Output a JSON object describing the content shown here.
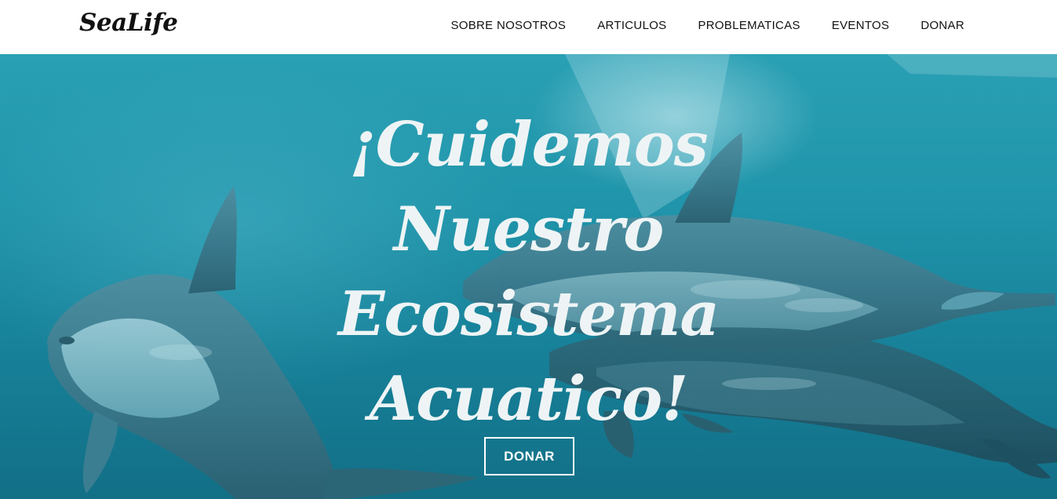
{
  "brand": {
    "name": "SeaLife"
  },
  "nav": {
    "items": [
      {
        "label": "SOBRE NOSOTROS"
      },
      {
        "label": "ARTICULOS"
      },
      {
        "label": "PROBLEMATICAS"
      },
      {
        "label": "EVENTOS"
      },
      {
        "label": "DONAR"
      }
    ]
  },
  "hero": {
    "title_lines": [
      "¡Cuidemos",
      "Nuestro",
      "Ecosistema",
      "Acuatico!"
    ],
    "button_label": "DONAR",
    "image": "dolphins-underwater-photo"
  },
  "colors": {
    "water_top": "#2aa0b4",
    "water_bottom": "#126f86",
    "hero_text": "#eef4f5",
    "nav_text": "#111111"
  }
}
